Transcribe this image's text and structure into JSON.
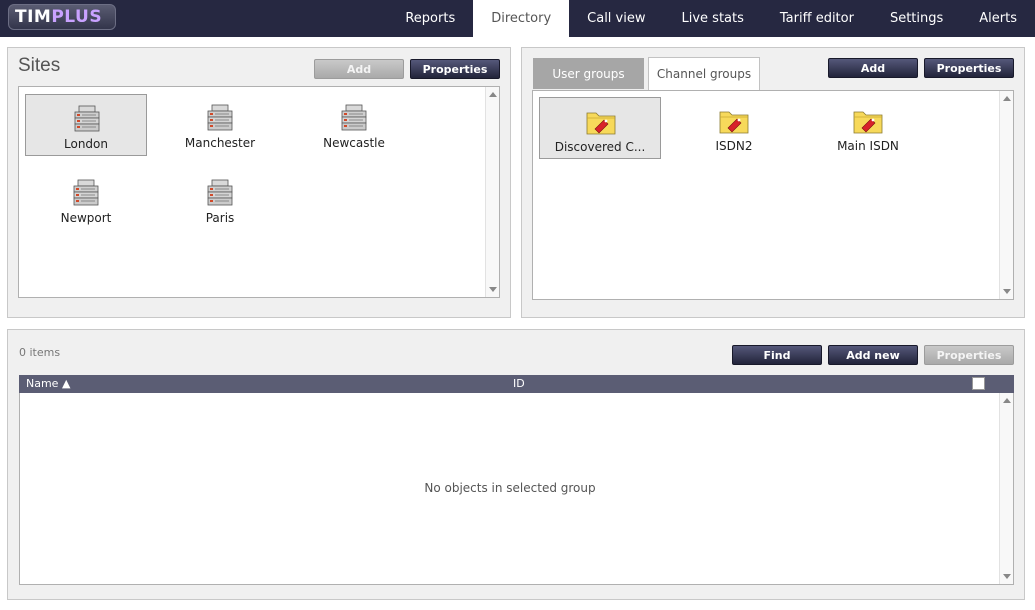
{
  "app": {
    "logo_text_1": "TIM",
    "logo_text_2": "PLUS"
  },
  "nav": {
    "items": [
      {
        "label": "Reports",
        "active": false
      },
      {
        "label": "Directory",
        "active": true
      },
      {
        "label": "Call view",
        "active": false
      },
      {
        "label": "Live stats",
        "active": false
      },
      {
        "label": "Tariff editor",
        "active": false
      },
      {
        "label": "Settings",
        "active": false
      },
      {
        "label": "Alerts",
        "active": false
      }
    ]
  },
  "sites_panel": {
    "title": "Sites",
    "add_label": "Add",
    "properties_label": "Properties",
    "sites": [
      {
        "label": "London",
        "selected": true
      },
      {
        "label": "Manchester",
        "selected": false
      },
      {
        "label": "Newcastle",
        "selected": false
      },
      {
        "label": "Newport",
        "selected": false
      },
      {
        "label": "Paris",
        "selected": false
      }
    ]
  },
  "groups_panel": {
    "tabs": [
      {
        "label": "User groups",
        "active": false
      },
      {
        "label": "Channel groups",
        "active": true
      }
    ],
    "add_label": "Add",
    "properties_label": "Properties",
    "groups": [
      {
        "label": "Discovered C...",
        "selected": true
      },
      {
        "label": "ISDN2",
        "selected": false
      },
      {
        "label": "Main ISDN",
        "selected": false
      }
    ]
  },
  "objects_panel": {
    "items_count": "0 items",
    "find_label": "Find",
    "add_new_label": "Add new",
    "properties_label": "Properties",
    "columns": {
      "name": "Name ▲",
      "id": "ID"
    },
    "empty_message": "No objects in selected group"
  },
  "colors": {
    "topbar": "#262841",
    "accent_logo": "#c9a2ff",
    "button_dark": "#22243a",
    "table_header": "#5b5d74"
  }
}
